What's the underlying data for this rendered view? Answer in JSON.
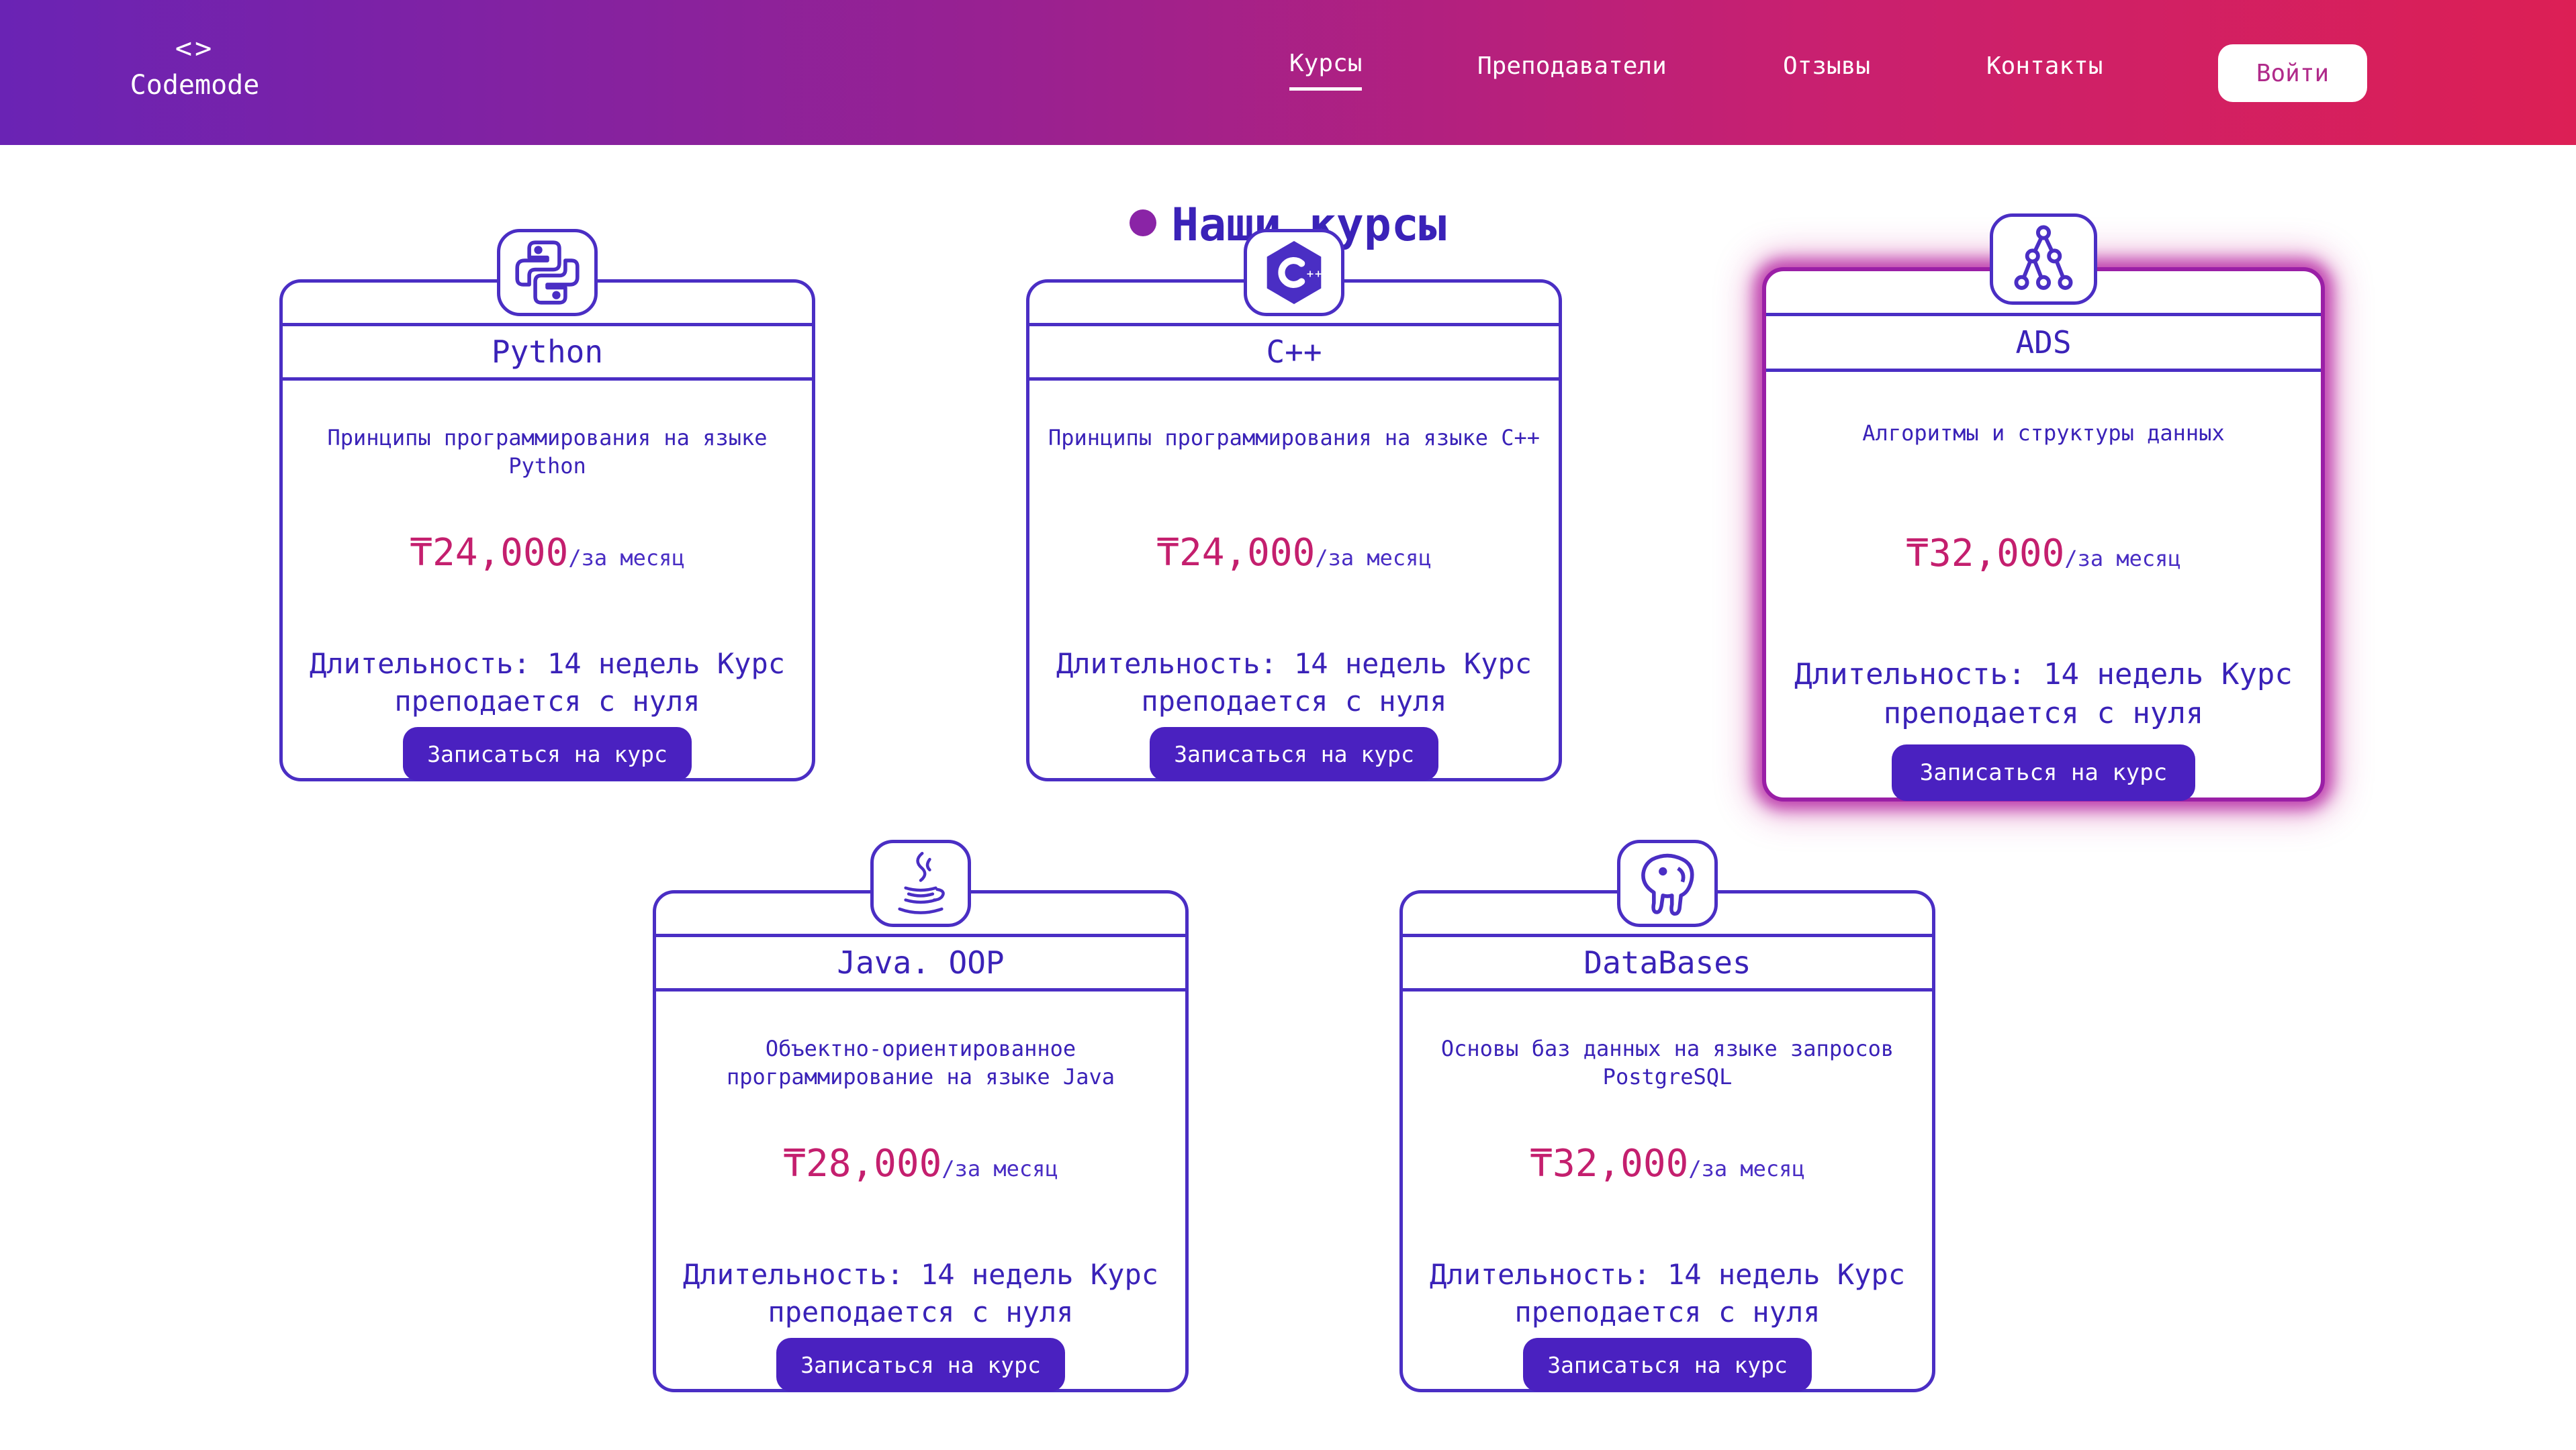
{
  "header": {
    "logo_icon": "<>",
    "logo_text": "Codemode",
    "nav": [
      "Курсы",
      "Преподаватели",
      "Отзывы",
      "Контакты"
    ],
    "login_label": "Войти"
  },
  "section_title": "Наши курсы",
  "courses": [
    {
      "title": "Python",
      "icon": "python-icon",
      "description": "Принципы программирования на языке Python",
      "price": "₸24,000",
      "period": "/за месяц",
      "info": "Длительность: 14 недель Курс преподается с нуля",
      "button": "Записаться на курс"
    },
    {
      "title": "C++",
      "icon": "cplusplus-icon",
      "description": "Принципы программирования на языке С++",
      "price": "₸24,000",
      "period": "/за месяц",
      "info": "Длительность: 14 недель Курс преподается с нуля",
      "button": "Записаться на курс"
    },
    {
      "title": "ADS",
      "icon": "algorithm-tree-icon",
      "description": "Алгоритмы и структуры данных",
      "price": "₸32,000",
      "period": "/за месяц",
      "info": "Длительность: 14 недель Курс преподается с нуля",
      "button": "Записаться на курс"
    },
    {
      "title": "Java. OOP",
      "icon": "java-icon",
      "description": "Объектно-ориентированное программирование на языке Java",
      "price": "₸28,000",
      "period": "/за месяц",
      "info": "Длительность: 14 недель Курс преподается с нуля",
      "button": "Записаться на курс"
    },
    {
      "title": "DataBases",
      "icon": "postgresql-icon",
      "description": "Основы баз данных на языке запросов PostgreSQL",
      "price": "₸32,000",
      "period": "/за месяц",
      "info": "Длительность: 14 недель Курс преподается с нуля",
      "button": "Записаться на курс"
    }
  ]
}
